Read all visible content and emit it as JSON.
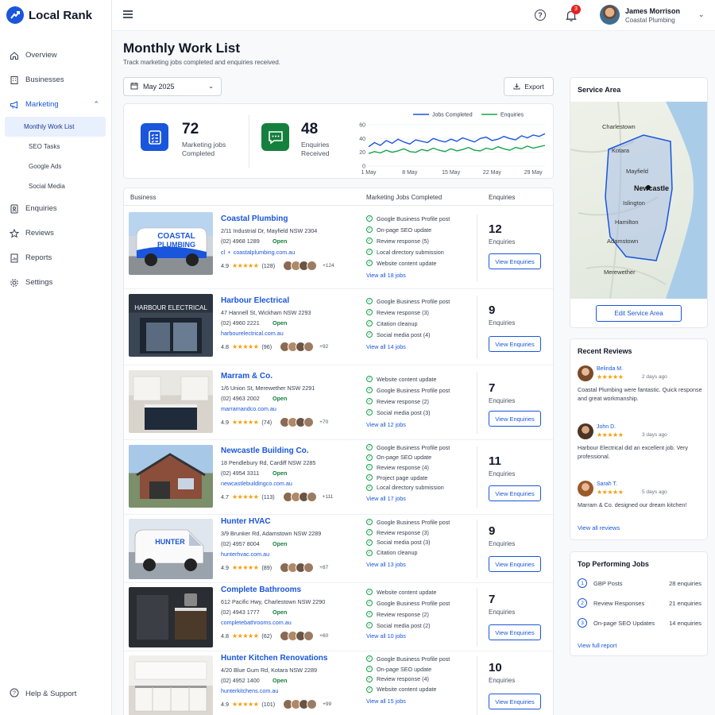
{
  "app": {
    "name": "Local Rank"
  },
  "sidebar": {
    "items": [
      {
        "label": "Overview"
      },
      {
        "label": "Businesses"
      },
      {
        "label": "Marketing"
      },
      {
        "label": "Enquiries"
      },
      {
        "label": "Reviews"
      },
      {
        "label": "Reports"
      },
      {
        "label": "Settings"
      }
    ],
    "marketing_sub": [
      {
        "label": "Monthly Work List"
      },
      {
        "label": "SEO Tasks"
      },
      {
        "label": "Google Ads"
      },
      {
        "label": "Social Media"
      }
    ],
    "help": "Help & Support"
  },
  "topbar": {
    "notifications": "3",
    "user_name": "James Morrison",
    "user_company": "Coastal Plumbing"
  },
  "page": {
    "title": "Monthly Work List",
    "subtitle": "Track marketing jobs completed and enquiries received.",
    "month": "May 2025",
    "export": "Export"
  },
  "stats": {
    "jobs_value": "72",
    "jobs_label_1": "Marketing jobs",
    "jobs_label_2": "Completed",
    "enq_value": "48",
    "enq_label_1": "Enquiries",
    "enq_label_2": "Received"
  },
  "chart_data": {
    "type": "line",
    "x": [
      "1 May",
      "2 May",
      "3 May",
      "4 May",
      "5 May",
      "6 May",
      "7 May",
      "8 May",
      "9 May",
      "10 May",
      "11 May",
      "12 May",
      "13 May",
      "14 May",
      "15 May",
      "16 May",
      "17 May",
      "18 May",
      "19 May",
      "20 May",
      "21 May",
      "22 May",
      "23 May",
      "24 May",
      "25 May",
      "26 May",
      "27 May",
      "28 May",
      "29 May",
      "30 May",
      "31 May"
    ],
    "xticks": [
      "1 May",
      "8 May",
      "15 May",
      "22 May",
      "29 May"
    ],
    "yticks": [
      "0",
      "20",
      "40",
      "60"
    ],
    "ylim": [
      0,
      60
    ],
    "legend_position": "top",
    "series": [
      {
        "name": "Jobs Completed",
        "color": "#1a56db",
        "values": [
          28,
          34,
          30,
          37,
          33,
          39,
          35,
          32,
          38,
          36,
          34,
          40,
          37,
          35,
          39,
          36,
          41,
          38,
          35,
          40,
          42,
          37,
          39,
          43,
          40,
          38,
          44,
          41,
          45,
          43,
          47
        ]
      },
      {
        "name": "Enquiries",
        "color": "#16a34a",
        "values": [
          18,
          21,
          19,
          23,
          20,
          22,
          25,
          21,
          20,
          24,
          22,
          26,
          23,
          21,
          25,
          22,
          24,
          27,
          23,
          22,
          26,
          24,
          28,
          25,
          23,
          27,
          25,
          29,
          26,
          28,
          30
        ]
      }
    ]
  },
  "table": {
    "headers": {
      "business": "Business",
      "jobs": "Marketing Jobs Completed",
      "enquiries": "Enquiries"
    },
    "enquiries_label": "Enquiries",
    "view_button": "View Enquiries",
    "open_label": "Open",
    "rows": [
      {
        "name": "Coastal Plumbing",
        "address": "2/11 Industrial Dr, Mayfield NSW 2304",
        "phone": "(02) 4968 1289",
        "url": "coastalplumbing.com.au",
        "url_prefix": "cl",
        "rating": "4.9",
        "reviews": "(128)",
        "more": "+124",
        "jobs": [
          "Google Business Profile post",
          "On-page SEO update",
          "Review response (5)",
          "Local directory submission",
          "Website content update"
        ],
        "view_all": "View all 18 jobs",
        "enquiries": "12"
      },
      {
        "name": "Harbour Electrical",
        "address": "47 Hannell St, Wickham NSW 2293",
        "phone": "(02) 4960 2221",
        "url": "harbourelectrical.com.au",
        "rating": "4.8",
        "reviews": "(96)",
        "more": "+92",
        "sign": "HARBOUR ELECTRICAL",
        "jobs": [
          "Google Business Profile post",
          "Review response (3)",
          "Citation cleanup",
          "Social media post (4)"
        ],
        "view_all": "View all 14 jobs",
        "enquiries": "9"
      },
      {
        "name": "Marram & Co.",
        "address": "1/6 Union St, Merewether NSW 2291",
        "phone": "(02) 4963 2002",
        "url": "marramandco.com.au",
        "rating": "4.9",
        "reviews": "(74)",
        "more": "+70",
        "jobs": [
          "Website content update",
          "Google Business Profile post",
          "Review response (2)",
          "Social media post (3)"
        ],
        "view_all": "View all 12 jobs",
        "enquiries": "7"
      },
      {
        "name": "Newcastle Building Co.",
        "address": "18 Pendlebury Rd, Cardiff NSW 2285",
        "phone": "(02) 4954 3311",
        "url": "newcastlebuildingco.com.au",
        "rating": "4.7",
        "reviews": "(113)",
        "more": "+111",
        "jobs": [
          "Google Business Profile post",
          "On-page SEO update",
          "Review response (4)",
          "Project page update",
          "Local directory submission"
        ],
        "view_all": "View all 17 jobs",
        "enquiries": "11"
      },
      {
        "name": "Hunter HVAC",
        "address": "3/9 Brunker Rd, Adamstown NSW 2289",
        "phone": "(02) 4957 8004",
        "url": "hunterhvac.com.au",
        "rating": "4.9",
        "reviews": "(89)",
        "more": "+87",
        "jobs": [
          "Google Business Profile post",
          "Review response (3)",
          "Social media post (3)",
          "Citation cleanup"
        ],
        "view_all": "View all 13 jobs",
        "enquiries": "9"
      },
      {
        "name": "Complete Bathrooms",
        "address": "612 Pacific Hwy, Charlestown NSW 2290",
        "phone": "(02) 4943 1777",
        "url": "completebathrooms.com.au",
        "rating": "4.8",
        "reviews": "(62)",
        "more": "+60",
        "jobs": [
          "Website content update",
          "Google Business Profile post",
          "Review response (2)",
          "Social media post (2)"
        ],
        "view_all": "View all 10 jobs",
        "enquiries": "7"
      },
      {
        "name": "Hunter Kitchen Renovations",
        "address": "4/20 Blue Gum Rd, Kotara NSW 2289",
        "phone": "(02) 4952 1400",
        "url": "hunterkitchens.com.au",
        "rating": "4.9",
        "reviews": "(101)",
        "more": "+99",
        "jobs": [
          "Google Business Profile post",
          "On-page SEO update",
          "Review response (4)",
          "Website content update"
        ],
        "view_all": "View all 15 jobs",
        "enquiries": "10"
      }
    ]
  },
  "service_area": {
    "title": "Service Area",
    "labels": [
      "Charlestown",
      "Kotara",
      "Mayfield",
      "Newcastle",
      "Islington",
      "Hamilton",
      "Adamstown",
      "Merewether"
    ],
    "button": "Edit Service Area"
  },
  "reviews": {
    "title": "Recent Reviews",
    "items": [
      {
        "name": "Belinda M.",
        "time": "2 days ago",
        "text": "Coastal Plumbing were fantastic. Quick response and great workmanship."
      },
      {
        "name": "John D.",
        "time": "3 days ago",
        "text": "Harbour Electrical did an excellent job. Very professional."
      },
      {
        "name": "Sarah T.",
        "time": "5 days ago",
        "text": "Marram & Co. designed our dream kitchen!"
      }
    ],
    "link": "View all reviews"
  },
  "top_jobs": {
    "title": "Top Performing Jobs",
    "items": [
      {
        "rank": "1",
        "label": "GBP Posts",
        "value": "28 enquiries"
      },
      {
        "rank": "2",
        "label": "Review Responses",
        "value": "21 enquiries"
      },
      {
        "rank": "3",
        "label": "On-page SEO Updates",
        "value": "14 enquiries"
      }
    ],
    "link": "View full report"
  }
}
